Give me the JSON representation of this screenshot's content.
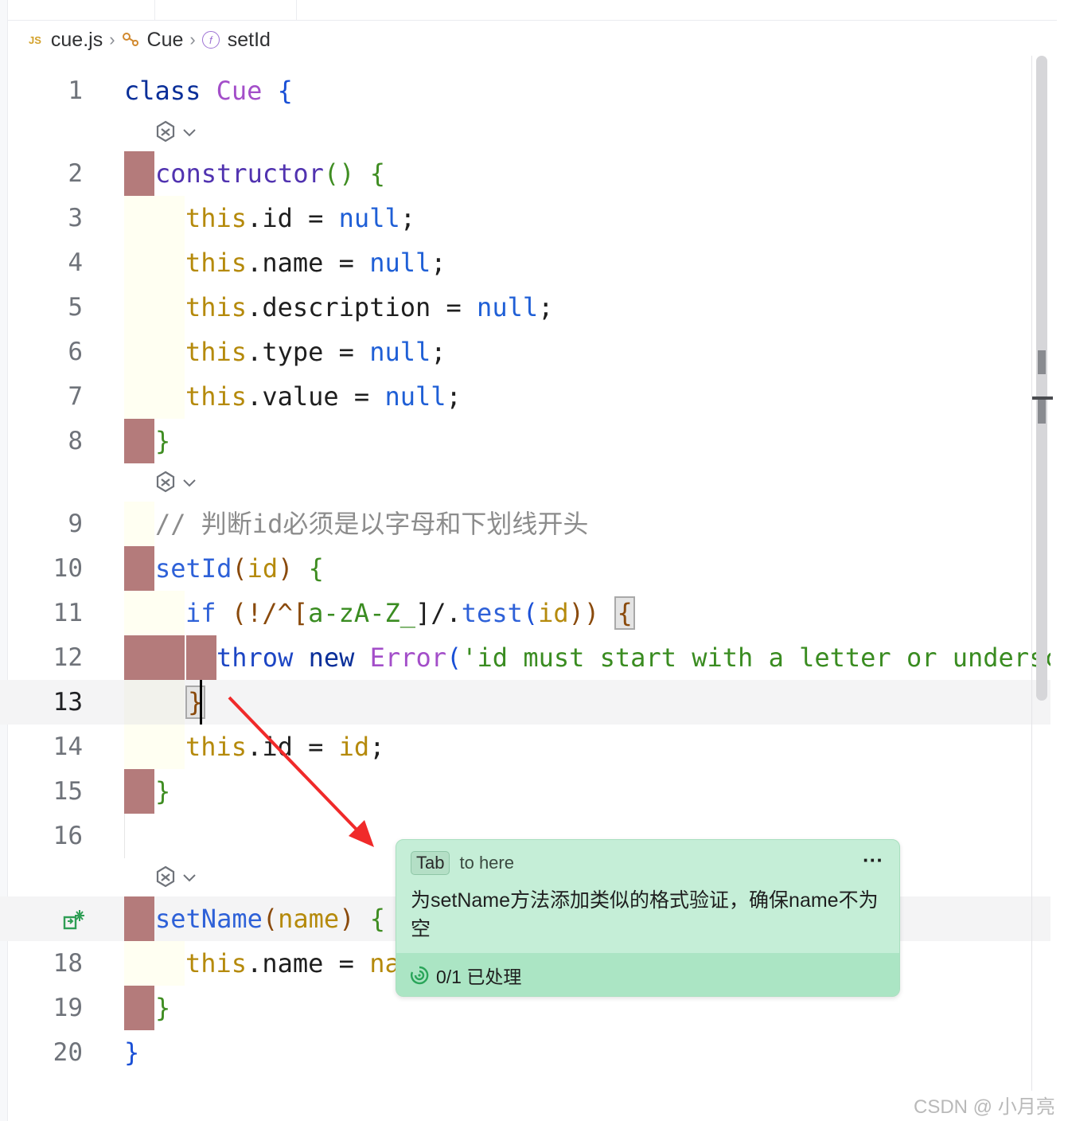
{
  "breadcrumb": {
    "file_badge": "JS",
    "file": "cue.js",
    "class": "Cue",
    "method": "setId"
  },
  "lines": {
    "l1": "1",
    "l2": "2",
    "l3": "3",
    "l4": "4",
    "l5": "5",
    "l6": "6",
    "l7": "7",
    "l8": "8",
    "l9": "9",
    "l10": "10",
    "l11": "11",
    "l12": "12",
    "l13": "13",
    "l14": "14",
    "l15": "15",
    "l16": "16",
    "l18": "18",
    "l19": "19",
    "l20": "20"
  },
  "code": {
    "class_kw": "class",
    "class_name": "Cue",
    "open_brace": "{",
    "constructor": "constructor",
    "ctor_paren": "()",
    "this_kw": "this",
    "prop_id": ".id",
    "prop_name": ".name",
    "prop_description": ".description",
    "prop_type": ".type",
    "prop_value": ".value",
    "assign": " = ",
    "null_kw": "null",
    "semicolon": ";",
    "close_brace": "}",
    "comment": "// 判断id必须是以字母和下划线开头",
    "setid_name": "setId",
    "param_id": "id",
    "if_kw": "if",
    "regex": "(!/^[a-zA-Z_]/.test(id))",
    "regex_p1": "(!/^[",
    "regex_p2": "a-zA-Z_",
    "regex_p3": "]/.",
    "regex_p4": "test",
    "regex_p5": "(",
    "regex_p6": "id",
    "regex_p7": "))",
    "throw_kw": "throw",
    "new_kw": "new",
    "error_cls": "Error",
    "error_msg": "'id must start with a letter or underscore')",
    "assign_id": " = ",
    "id_val": "id",
    "setname_name": "setName",
    "param_name": "name",
    "name_partial": "na"
  },
  "popup": {
    "tab_key": "Tab",
    "tab_text": "to here",
    "more": "···",
    "message": "为setName方法添加类似的格式验证，确保name不为空",
    "footer": "0/1 已处理"
  },
  "watermark": "CSDN @ 小月亮",
  "colors": {
    "gutter_mark": "#b47b7b",
    "popup_bg": "#c5eed7",
    "popup_footer": "#abe5c4",
    "arrow": "#f02a2a"
  }
}
